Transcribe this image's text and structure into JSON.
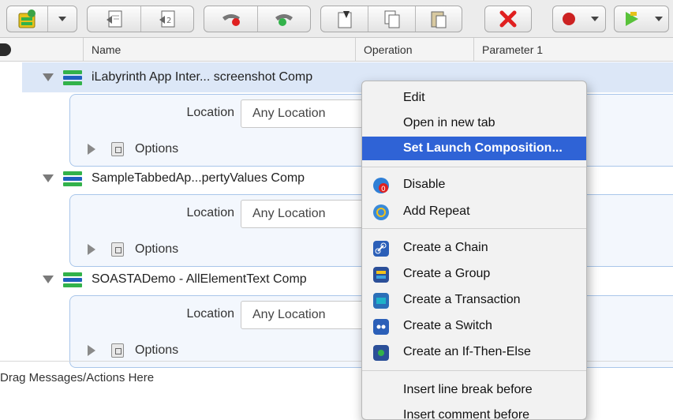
{
  "columns": {
    "name": "Name",
    "operation": "Operation",
    "parameter1": "Parameter 1"
  },
  "components": [
    {
      "title": "iLabyrinth App Inter... screenshot Comp",
      "location_label": "Location",
      "location_value": "Any Location",
      "options_label": "Options",
      "selected": true
    },
    {
      "title": "SampleTabbedAp...pertyValues Comp",
      "location_label": "Location",
      "location_value": "Any Location",
      "options_label": "Options",
      "selected": false
    },
    {
      "title": "SOASTADemo - AllElementText Comp",
      "location_label": "Location",
      "location_value": "Any Location",
      "options_label": "Options",
      "selected": false
    }
  ],
  "drag_hint": "Drag Messages/Actions Here",
  "context_menu": {
    "items": [
      {
        "label": "Edit",
        "icon": ""
      },
      {
        "label": "Open in new tab",
        "icon": ""
      },
      {
        "label": "Set Launch Composition...",
        "icon": "",
        "highlighted": true
      },
      {
        "label": "Disable",
        "icon": "disable-icon"
      },
      {
        "label": "Add Repeat",
        "icon": "repeat-icon"
      },
      {
        "label": "Create a Chain",
        "icon": "chain-icon"
      },
      {
        "label": "Create a Group",
        "icon": "group-icon"
      },
      {
        "label": "Create a Transaction",
        "icon": "transaction-icon"
      },
      {
        "label": "Create a Switch",
        "icon": "switch-icon"
      },
      {
        "label": "Create an If-Then-Else",
        "icon": "if-then-else-icon"
      },
      {
        "label": "Insert line break before",
        "icon": ""
      },
      {
        "label": "Insert comment before",
        "icon": ""
      }
    ]
  },
  "colors": {
    "selection": "#dce7f7",
    "menu_highlight": "#2f63d6",
    "panel_border": "#a9c6ea"
  }
}
